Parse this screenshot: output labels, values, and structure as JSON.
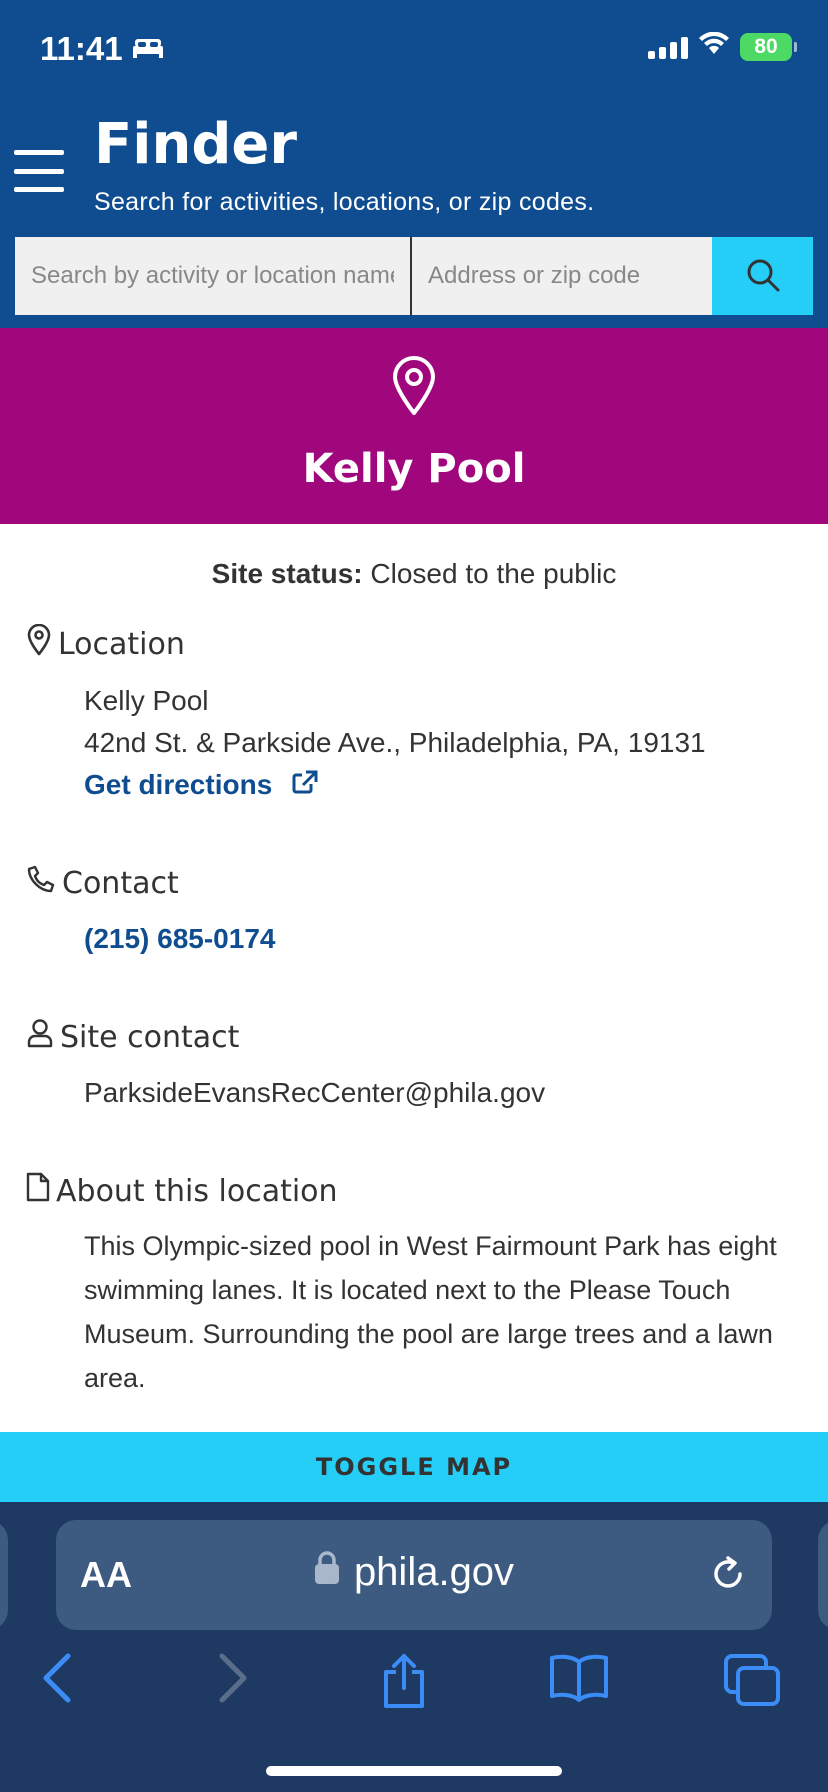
{
  "status_bar": {
    "time": "11:41",
    "battery": "80"
  },
  "header": {
    "title": "Finder",
    "subtitle": "Search for activities, locations, or zip codes."
  },
  "search": {
    "activity_placeholder": "Search by activity or location name",
    "address_placeholder": "Address or zip code"
  },
  "banner": {
    "name": "Kelly Pool"
  },
  "details": {
    "status_label": "Site status:",
    "status_value": "Closed to the public",
    "location_heading": "Location",
    "location_name": "Kelly Pool",
    "location_address": "42nd St. & Parkside Ave., Philadelphia, PA, 19131",
    "directions_label": "Get directions",
    "contact_heading": "Contact",
    "phone": "(215) 685-0174",
    "site_contact_heading": "Site contact",
    "site_contact_email": "ParksideEvansRecCenter@phila.gov",
    "about_heading": "About this location",
    "about_text": "This Olympic-sized pool in West Fairmount Park has eight swimming lanes. It is located next to the Please Touch Museum. Surrounding the pool are large trees and a lawn area."
  },
  "toggle_map_label": "TOGGLE MAP",
  "browser": {
    "text_size_label": "AA",
    "domain": "phila.gov"
  },
  "colors": {
    "header_blue": "#0f4d90",
    "banner_magenta": "#a1077d",
    "accent_cyan": "#25cef7",
    "link_blue": "#0f4d90"
  },
  "icons": [
    "bed-icon",
    "signal-icon",
    "wifi-icon",
    "battery-icon",
    "menu-icon",
    "search-icon",
    "map-pin-icon",
    "external-link-icon",
    "phone-icon",
    "user-icon",
    "document-icon",
    "lock-icon",
    "reload-icon",
    "back-icon",
    "forward-icon",
    "share-icon",
    "bookmarks-icon",
    "tabs-icon"
  ]
}
